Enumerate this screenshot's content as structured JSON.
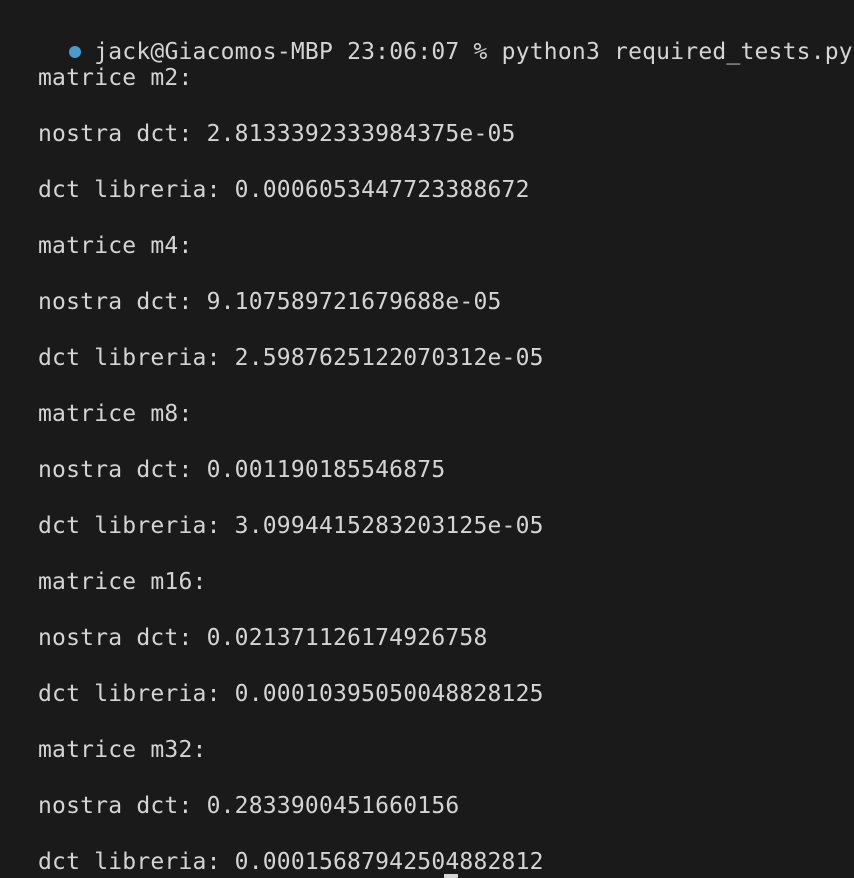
{
  "terminal": {
    "prompt": {
      "user_host": "jack@Giacomos-MBP",
      "time": "23:06:07",
      "symbol": "%",
      "command": "python3 required_tests.py",
      "dot_color": "#4a9ad1"
    },
    "output": [
      "matrice m2:",
      "nostra dct: 2.8133392333984375e-05",
      "dct libreria: 0.0006053447723388672",
      "matrice m4:",
      "nostra dct: 9.107589721679688e-05",
      "dct libreria: 2.5987625122070312e-05",
      "matrice m8:",
      "nostra dct: 0.001190185546875",
      "dct libreria: 3.0994415283203125e-05",
      "matrice m16:",
      "nostra dct: 0.021371126174926758",
      "dct libreria: 0.00010395050048828125",
      "matrice m32:",
      "nostra dct: 0.2833900451660156",
      "dct libreria: 0.00015687942504882812"
    ]
  }
}
